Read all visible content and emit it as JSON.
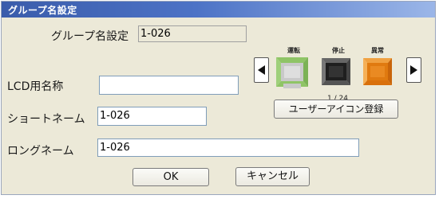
{
  "window": {
    "title": "グループ名設定"
  },
  "group_name": {
    "label": "グループ名設定",
    "value": "1-026"
  },
  "lcd_name": {
    "label": "LCD用名称",
    "value": ""
  },
  "short_name": {
    "label": "ショートネーム",
    "value": "1-026"
  },
  "long_name": {
    "label": "ロングネーム",
    "value": "1-026"
  },
  "icons": {
    "labels": [
      "運転",
      "停止",
      "異常"
    ],
    "names": [
      "unit-running-icon",
      "unit-stopped-icon",
      "unit-error-icon"
    ],
    "colors": {
      "running": "#8fc466",
      "stopped": "#555555",
      "error": "#e07a10"
    },
    "counter": "1 / 24"
  },
  "buttons": {
    "register_icon": "ユーザーアイコン登録",
    "ok": "OK",
    "cancel": "キャンセル"
  }
}
